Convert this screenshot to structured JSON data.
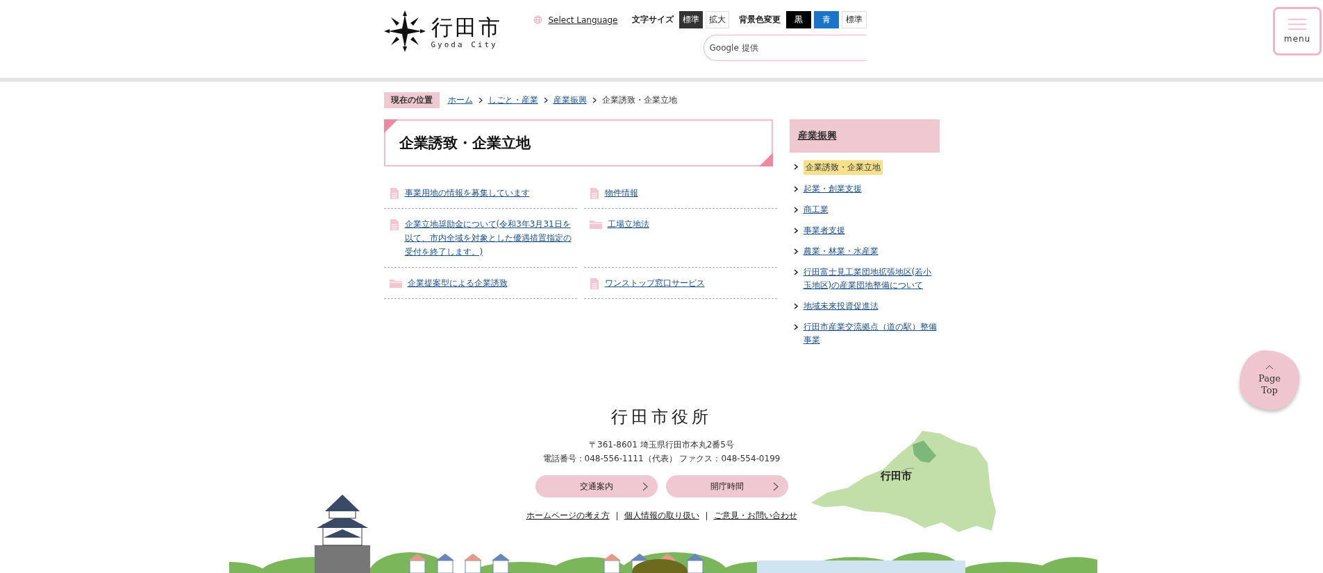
{
  "header": {
    "logo": {
      "name": "行田市",
      "romaji": "Gyoda City"
    },
    "language_link": "Select Language",
    "font_size": {
      "label": "文字サイズ",
      "options": [
        {
          "label": "標準",
          "selected": true
        },
        {
          "label": "拡大",
          "selected": false
        }
      ]
    },
    "background_color": {
      "label": "背景色変更",
      "options": [
        {
          "label": "黒",
          "kind": "black"
        },
        {
          "label": "青",
          "kind": "blue"
        },
        {
          "label": "標準",
          "kind": "standard"
        }
      ]
    },
    "search": {
      "placeholder": "Google 提供"
    },
    "menu_button": "menu"
  },
  "breadcrumb": {
    "label": "現在の位置",
    "items": [
      {
        "label": "ホーム",
        "link": true
      },
      {
        "label": "しごと・産業",
        "link": true
      },
      {
        "label": "産業振興",
        "link": true
      },
      {
        "label": "企業誘致・企業立地",
        "link": false
      }
    ]
  },
  "page_title": "企業誘致・企業立地",
  "links": [
    {
      "label": "事業用地の情報を募集しています",
      "kind": "page"
    },
    {
      "label": "物件情報",
      "kind": "page"
    },
    {
      "label": "企業立地奨励金について(令和3年3月31日を以て、市内全域を対象とした優遇措置指定の受付を終了します。)",
      "kind": "page"
    },
    {
      "label": "工場立地法",
      "kind": "folder"
    },
    {
      "label": "企業提案型による企業誘致",
      "kind": "folder"
    },
    {
      "label": "ワンストップ窓口サービス",
      "kind": "page"
    }
  ],
  "sidebar": {
    "heading": "産業振興",
    "items": [
      {
        "label": "企業誘致・企業立地",
        "selected": true
      },
      {
        "label": "起業・創業支援",
        "selected": false
      },
      {
        "label": "商工業",
        "selected": false
      },
      {
        "label": "事業者支援",
        "selected": false
      },
      {
        "label": "農業・林業・水産業",
        "selected": false
      },
      {
        "label": "行田富士見工業団地拡張地区(若小玉地区)の産業団地整備について",
        "selected": false
      },
      {
        "label": "地域未来投資促進法",
        "selected": false
      },
      {
        "label": "行田市産業交流拠点（道の駅）整備事業",
        "selected": false
      }
    ]
  },
  "page_top": "Page Top",
  "footer": {
    "title": "行田市役所",
    "address": "〒361-8601 埼玉県行田市本丸2番5号",
    "phone": "電話番号：048-556-1111（代表） ファクス：048-554-0199",
    "buttons": [
      "交通案内",
      "開庁時間"
    ],
    "links": [
      "ホームページの考え方",
      "個人情報の取り扱い",
      "ご意見・お問い合わせ"
    ],
    "map_label": "行田市"
  }
}
